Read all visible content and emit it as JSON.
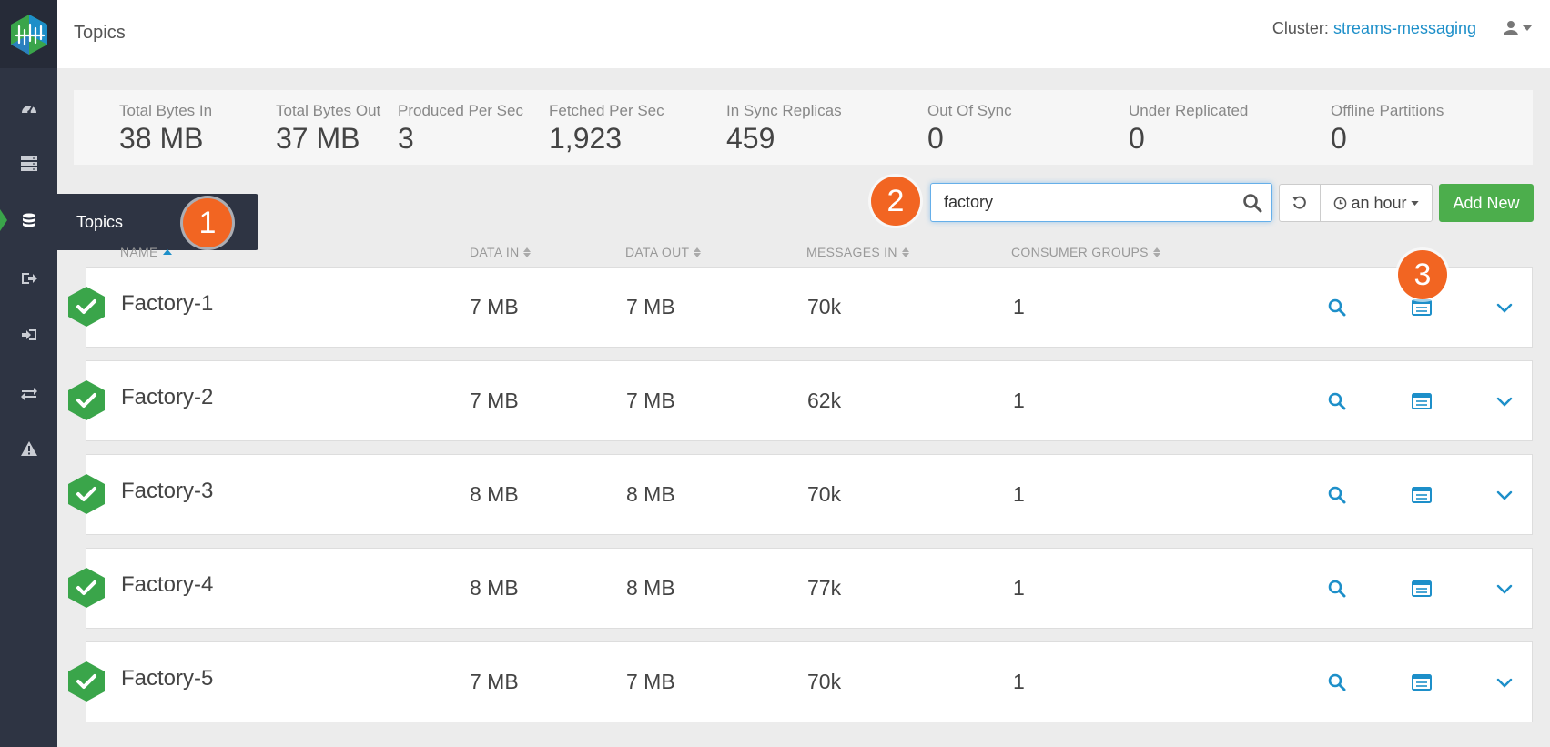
{
  "header": {
    "title": "Topics",
    "cluster_label": "Cluster:",
    "cluster_name": "streams-messaging"
  },
  "sidebar": {
    "items": [
      {
        "icon": "dashboard-icon"
      },
      {
        "icon": "brokers-icon"
      },
      {
        "icon": "topics-icon",
        "active": true
      },
      {
        "icon": "producers-icon"
      },
      {
        "icon": "consumers-icon"
      },
      {
        "icon": "replication-icon"
      },
      {
        "icon": "alerts-icon"
      }
    ],
    "tooltip": "Topics"
  },
  "stats": [
    {
      "label": "Total Bytes In",
      "value": "38 MB"
    },
    {
      "label": "Total Bytes Out",
      "value": "37 MB"
    },
    {
      "label": "Produced Per Sec",
      "value": "3"
    },
    {
      "label": "Fetched Per Sec",
      "value": "1,923"
    },
    {
      "label": "In Sync Replicas",
      "value": "459"
    },
    {
      "label": "Out Of Sync",
      "value": "0"
    },
    {
      "label": "Under Replicated",
      "value": "0"
    },
    {
      "label": "Offline Partitions",
      "value": "0"
    }
  ],
  "toolbar": {
    "search_value": "factory",
    "time_range": "an hour",
    "add_label": "Add New"
  },
  "badges": [
    "1",
    "2",
    "3"
  ],
  "table": {
    "columns": [
      "NAME",
      "DATA IN",
      "DATA OUT",
      "MESSAGES IN",
      "CONSUMER GROUPS"
    ],
    "rows": [
      {
        "name": "Factory-1",
        "data_in": "7 MB",
        "data_out": "7 MB",
        "messages_in": "70k",
        "consumer_groups": "1"
      },
      {
        "name": "Factory-2",
        "data_in": "7 MB",
        "data_out": "7 MB",
        "messages_in": "62k",
        "consumer_groups": "1"
      },
      {
        "name": "Factory-3",
        "data_in": "8 MB",
        "data_out": "8 MB",
        "messages_in": "70k",
        "consumer_groups": "1"
      },
      {
        "name": "Factory-4",
        "data_in": "8 MB",
        "data_out": "8 MB",
        "messages_in": "77k",
        "consumer_groups": "1"
      },
      {
        "name": "Factory-5",
        "data_in": "7 MB",
        "data_out": "7 MB",
        "messages_in": "70k",
        "consumer_groups": "1"
      }
    ]
  },
  "colors": {
    "accent": "#1d8fc9",
    "success": "#3aa54a",
    "badge": "#f26522",
    "sidebar": "#2e3443"
  }
}
